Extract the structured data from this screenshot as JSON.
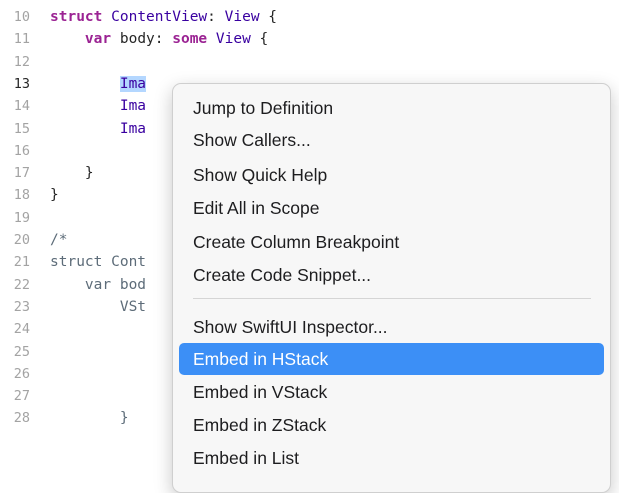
{
  "editor": {
    "lines": [
      {
        "n": "10",
        "parts": [
          {
            "t": "struct",
            "c": "kw"
          },
          {
            "t": " "
          },
          {
            "t": "ContentView",
            "c": "ty"
          },
          {
            "t": ": "
          },
          {
            "t": "View",
            "c": "ty"
          },
          {
            "t": " {"
          }
        ]
      },
      {
        "n": "11",
        "parts": [
          {
            "t": "    "
          },
          {
            "t": "var",
            "c": "kw"
          },
          {
            "t": " body: "
          },
          {
            "t": "some",
            "c": "kw"
          },
          {
            "t": " "
          },
          {
            "t": "View",
            "c": "ty"
          },
          {
            "t": " {"
          }
        ]
      },
      {
        "n": "12",
        "parts": []
      },
      {
        "n": "13",
        "parts": [
          {
            "t": "        "
          },
          {
            "t": "Ima",
            "c": "ty sel"
          }
        ]
      },
      {
        "n": "14",
        "parts": [
          {
            "t": "        "
          },
          {
            "t": "Ima",
            "c": "ty"
          }
        ]
      },
      {
        "n": "15",
        "parts": [
          {
            "t": "        "
          },
          {
            "t": "Ima",
            "c": "ty"
          }
        ]
      },
      {
        "n": "16",
        "parts": []
      },
      {
        "n": "17",
        "parts": [
          {
            "t": "    }"
          }
        ]
      },
      {
        "n": "18",
        "parts": [
          {
            "t": "}"
          }
        ]
      },
      {
        "n": "19",
        "parts": []
      },
      {
        "n": "20",
        "parts": [
          {
            "t": "/*",
            "c": "cm"
          }
        ]
      },
      {
        "n": "21",
        "parts": [
          {
            "t": "struct Cont",
            "c": "cm"
          }
        ]
      },
      {
        "n": "22",
        "parts": [
          {
            "t": "    var bod",
            "c": "cm"
          }
        ]
      },
      {
        "n": "23",
        "parts": [
          {
            "t": "        VSt",
            "c": "cm"
          }
        ]
      },
      {
        "n": "24",
        "parts": []
      },
      {
        "n": "25",
        "parts": []
      },
      {
        "n": "26",
        "parts": []
      },
      {
        "n": "27",
        "parts": []
      },
      {
        "n": "28",
        "parts": [
          {
            "t": "        }",
            "c": "cm"
          }
        ]
      }
    ],
    "current_line": "13"
  },
  "context_menu": {
    "items": [
      {
        "label": "Jump to Definition"
      },
      {
        "label": "Show Callers..."
      },
      {
        "label": "Show Quick Help"
      },
      {
        "label": "Edit All in Scope"
      },
      {
        "label": "Create Column Breakpoint"
      },
      {
        "label": "Create Code Snippet..."
      },
      {
        "separator": true
      },
      {
        "label": "Show SwiftUI Inspector..."
      },
      {
        "label": "Embed in HStack",
        "highlighted": true
      },
      {
        "label": "Embed in VStack"
      },
      {
        "label": "Embed in ZStack"
      },
      {
        "label": "Embed in List"
      }
    ]
  },
  "colors": {
    "keyword": "#9b2393",
    "type": "#3900a0",
    "comment": "#5d6c79",
    "selection": "#b4d7ff",
    "menu_highlight": "#3c8ff6"
  }
}
